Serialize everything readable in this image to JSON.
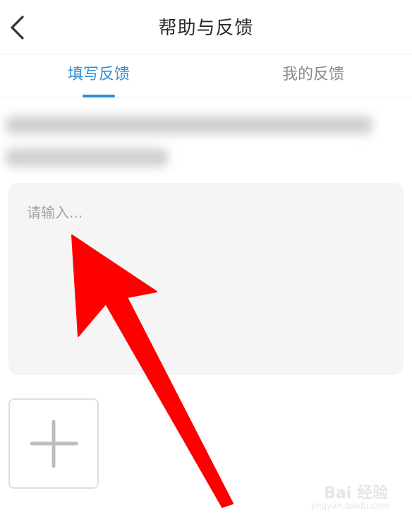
{
  "header": {
    "title": "帮助与反馈",
    "back_icon": "chevron-left-icon"
  },
  "tabs": [
    {
      "label": "填写反馈",
      "active": true
    },
    {
      "label": "我的反馈",
      "active": false
    }
  ],
  "feedback": {
    "placeholder": "请输入...",
    "value": ""
  },
  "upload": {
    "icon": "plus-icon"
  },
  "annotation": {
    "arrow_color": "#ff0000",
    "icon": "arrow-icon"
  },
  "watermark": {
    "logo": "Bai 经验",
    "url": "jingyan.baidu.com"
  },
  "colors": {
    "accent": "#2f8fd8",
    "input_bg": "#f5f5f5"
  }
}
